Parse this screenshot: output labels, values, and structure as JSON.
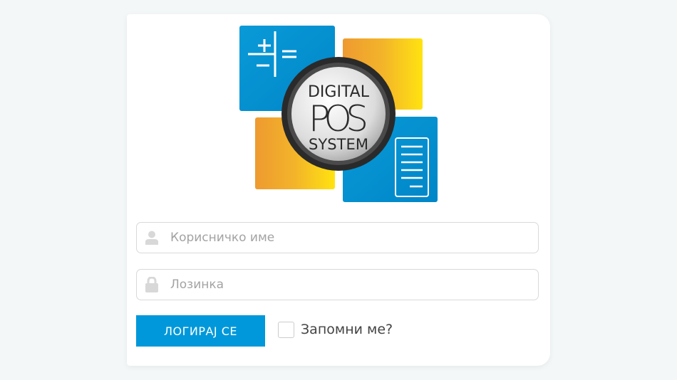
{
  "logo": {
    "line1": "DIGITAL",
    "line2": "POS",
    "line3": "SYSTEM"
  },
  "form": {
    "username_placeholder": "Корисничко име",
    "password_placeholder": "Лозинка",
    "login_label": "ЛОГИРАЈ СЕ",
    "remember_label": "Запомни ме?"
  },
  "colors": {
    "accent": "#0098da",
    "blue_tile": "#0093d2",
    "orange": "#f0a030",
    "yellow": "#ffe000"
  }
}
